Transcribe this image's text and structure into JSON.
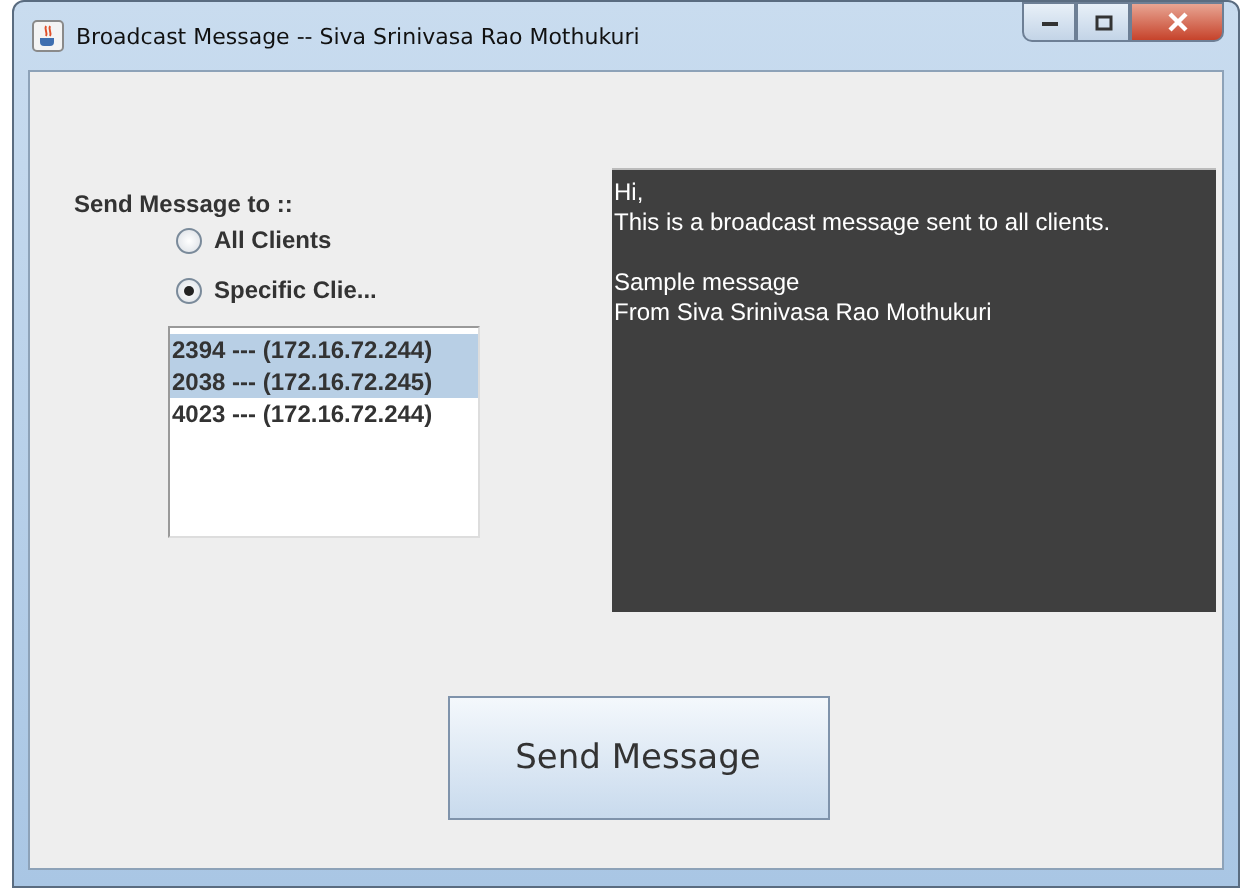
{
  "window": {
    "title": "Broadcast Message -- Siva Srinivasa Rao Mothukuri"
  },
  "recipients": {
    "label": "Send Message to ::",
    "options": [
      {
        "label": "All Clients",
        "selected": false
      },
      {
        "label": "Specific Clie...",
        "selected": true
      }
    ]
  },
  "clients": [
    {
      "label": "2394 --- (172.16.72.244)",
      "selected": true
    },
    {
      "label": "2038 --- (172.16.72.245)",
      "selected": true
    },
    {
      "label": "4023 --- (172.16.72.244)",
      "selected": false
    }
  ],
  "message": {
    "value": "Hi,\nThis is a broadcast message sent to all clients.\n\nSample message\nFrom Siva Srinivasa Rao Mothukuri"
  },
  "send_button": {
    "label": "Send Message"
  }
}
